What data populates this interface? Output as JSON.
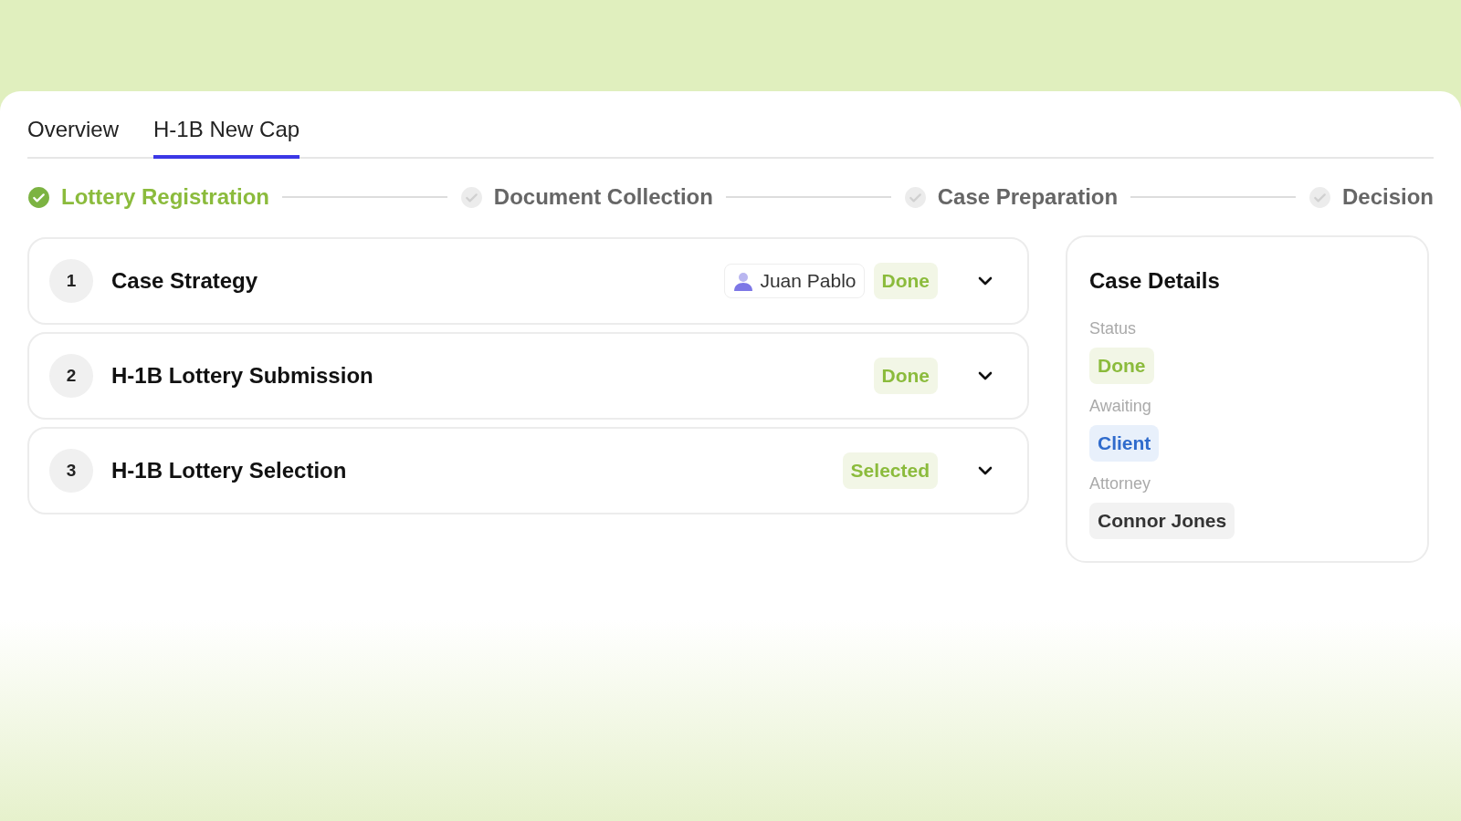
{
  "tabs": [
    {
      "label": "Overview",
      "selected": false
    },
    {
      "label": "H-1B New Cap",
      "selected": true
    }
  ],
  "steps": [
    {
      "label": "Lottery Registration",
      "completed": true
    },
    {
      "label": "Document Collection",
      "completed": false
    },
    {
      "label": "Case Preparation",
      "completed": false
    },
    {
      "label": "Decision",
      "completed": false
    }
  ],
  "tasks": [
    {
      "number": "1",
      "title": "Case Strategy",
      "assignee": "Juan Pablo",
      "status": "Done",
      "expanded": false
    },
    {
      "number": "2",
      "title": "H-1B Lottery Submission",
      "status": "Done",
      "expanded": false
    },
    {
      "number": "3",
      "title": "H-1B Lottery Selection",
      "status": "Selected",
      "expanded": false
    }
  ],
  "case_details": {
    "title": "Case Details",
    "fields": [
      {
        "label": "Status",
        "value": "Done",
        "kind": "success"
      },
      {
        "label": "Awaiting",
        "value": "Client",
        "kind": "info"
      },
      {
        "label": "Attorney",
        "value": "Connor Jones",
        "kind": "neutral"
      }
    ]
  }
}
